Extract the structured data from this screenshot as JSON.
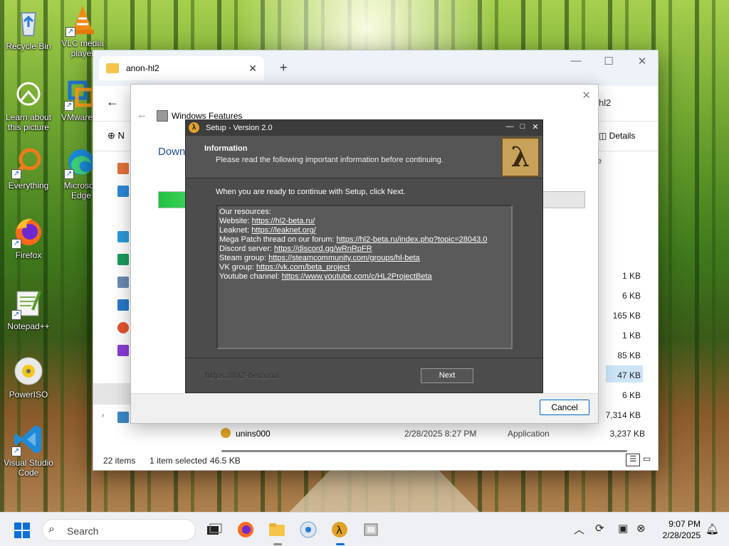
{
  "desktop": {
    "icons": [
      {
        "label": "Recycle Bin",
        "icon": "recycle-bin-icon"
      },
      {
        "label": "VLC media player",
        "icon": "vlc-icon"
      },
      {
        "label": "Learn about this picture",
        "icon": "learn-icon"
      },
      {
        "label": "VMware Workstation",
        "icon": "vmware-icon"
      },
      {
        "label": "Everything",
        "icon": "everything-icon"
      },
      {
        "label": "Microsoft Edge",
        "icon": "edge-icon"
      },
      {
        "label": "Firefox",
        "icon": "firefox-icon"
      },
      {
        "label": "Notepad++",
        "icon": "notepadpp-icon"
      },
      {
        "label": "PowerISO",
        "icon": "poweriso-icon"
      },
      {
        "label": "Visual Studio Code",
        "icon": "vscode-icon"
      }
    ]
  },
  "explorer": {
    "tab_title": "anon-hl2",
    "address_tail": "hl2",
    "new_label": "N",
    "details_label": "Details",
    "size_column": "ize",
    "sizes": [
      "1 KB",
      "6 KB",
      "165 KB",
      "1 KB",
      "85 KB",
      "47 KB",
      "6 KB",
      "7,314 KB"
    ],
    "last_row": {
      "name": "unins000",
      "date": "2/28/2025 8:27 PM",
      "type": "Application",
      "size": "3,237 KB"
    },
    "status": {
      "items": "22 items",
      "selected": "1 item selected",
      "size": "46.5 KB"
    }
  },
  "features": {
    "title": "Windows Features",
    "heading": "Down",
    "progress": 0.08,
    "cancel_label": "Cancel"
  },
  "setup": {
    "title": "Setup - Version 2.0",
    "header_title": "Information",
    "header_subtitle": "Please read the following important information before continuing.",
    "intro": "When you are ready to continue with Setup, click Next.",
    "memo": {
      "heading": "Our resources:",
      "lines": [
        {
          "label": "Website: ",
          "link": "https://hl2-beta.ru/"
        },
        {
          "label": "Leaknet: ",
          "link": "https://leaknet.org/"
        },
        {
          "label": "Mega Patch thread on our forum: ",
          "link": "https://hl2-beta.ru/index.php?topic=28043.0"
        },
        {
          "label": "Discord server: ",
          "link": "https://discord.gg/wRnRpFR"
        },
        {
          "label": "Steam group: ",
          "link": "https://steamcommunity.com/groups/hl-beta"
        },
        {
          "label": "VK group: ",
          "link": "https://vk.com/beta_project"
        },
        {
          "label": "Youtube channel: ",
          "link": "https://www.youtube.com/c/HL2ProjectBeta"
        }
      ]
    },
    "brand": "https://hl2-beta.ru/",
    "next_label": "Next"
  },
  "taskbar": {
    "search_placeholder": "Search",
    "time": "9:07 PM",
    "date": "2/28/2025"
  }
}
